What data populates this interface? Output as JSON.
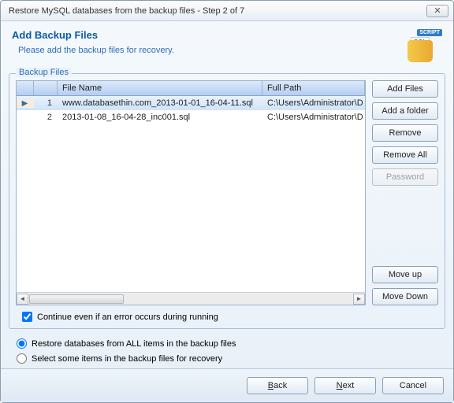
{
  "window_title": "Restore MySQL databases from the backup files - Step 2 of 7",
  "header": {
    "title": "Add Backup Files",
    "subtitle": "Please add the backup files for recovery.",
    "icon_badge": "SCRIPT",
    "icon_sql": "SQL"
  },
  "fieldset_legend": "Backup Files",
  "grid": {
    "columns": {
      "file_name": "File Name",
      "full_path": "Full Path"
    },
    "rows": [
      {
        "index": "1",
        "selected": true,
        "file_name": "www.databasethin.com_2013-01-01_16-04-11.sql",
        "full_path": "C:\\Users\\Administrator\\D"
      },
      {
        "index": "2",
        "selected": false,
        "file_name": "2013-01-08_16-04-28_inc001.sql",
        "full_path": "C:\\Users\\Administrator\\D"
      }
    ]
  },
  "side_buttons": {
    "add_files": "Add Files",
    "add_folder": "Add a folder",
    "remove": "Remove",
    "remove_all": "Remove All",
    "password": "Password",
    "move_up": "Move up",
    "move_down": "Move Down"
  },
  "continue_checkbox": {
    "label": "Continue even if an error occurs during running",
    "checked": true
  },
  "radios": {
    "restore_all": {
      "label": "Restore databases from ALL items in the backup files",
      "checked": true
    },
    "select_some": {
      "label": "Select some items in the backup files for recovery",
      "checked": false
    }
  },
  "footer": {
    "back_prefix": "B",
    "back_rest": "ack",
    "next_prefix": "N",
    "next_rest": "ext",
    "cancel": "Cancel"
  }
}
